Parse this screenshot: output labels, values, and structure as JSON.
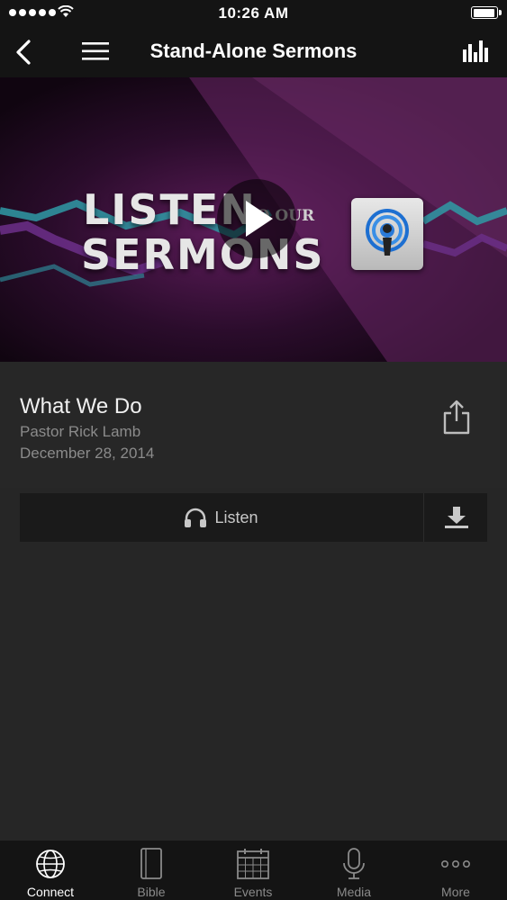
{
  "status_bar": {
    "time": "10:26 AM"
  },
  "header": {
    "title": "Stand-Alone Sermons"
  },
  "hero": {
    "line1": "LISTEN",
    "line2": "SERMONS",
    "small": "TO OUR"
  },
  "sermon": {
    "title": "What We Do",
    "speaker": "Pastor Rick Lamb",
    "date": "December 28, 2014"
  },
  "actions": {
    "listen_label": "Listen"
  },
  "tabs": [
    {
      "label": "Connect",
      "icon": "globe-icon",
      "active": true
    },
    {
      "label": "Bible",
      "icon": "book-icon",
      "active": false
    },
    {
      "label": "Events",
      "icon": "calendar-icon",
      "active": false
    },
    {
      "label": "Media",
      "icon": "microphone-icon",
      "active": false
    },
    {
      "label": "More",
      "icon": "more-icon",
      "active": false
    }
  ],
  "colors": {
    "background": "#262626",
    "bar": "#141414",
    "active_tab": "#ffffff",
    "inactive_tab": "#8a8a8a"
  }
}
